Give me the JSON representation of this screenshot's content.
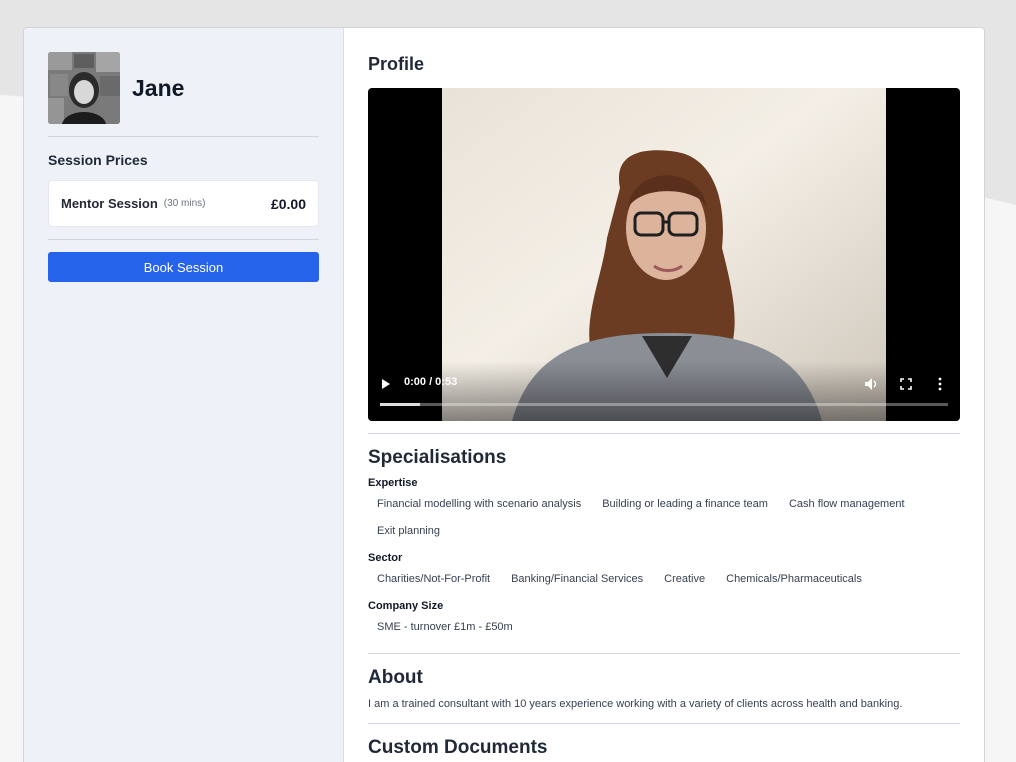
{
  "mentor": {
    "name": "Jane"
  },
  "session_prices": {
    "title": "Session Prices",
    "items": [
      {
        "name": "Mentor Session",
        "duration": "(30 mins)",
        "price": "£0.00"
      }
    ],
    "book_label": "Book Session"
  },
  "profile": {
    "title": "Profile",
    "video": {
      "time": "0:00 / 0:53",
      "progress": 0.07
    }
  },
  "specialisations": {
    "title": "Specialisations",
    "groups": [
      {
        "label": "Expertise",
        "tags": [
          "Financial modelling with scenario analysis",
          "Building or leading a finance team",
          "Cash flow management",
          "Exit planning"
        ]
      },
      {
        "label": "Sector",
        "tags": [
          "Charities/Not-For-Profit",
          "Banking/Financial Services",
          "Creative",
          "Chemicals/Pharmaceuticals"
        ]
      },
      {
        "label": "Company Size",
        "tags": [
          "SME - turnover £1m - £50m"
        ]
      }
    ]
  },
  "about": {
    "title": "About",
    "text": "I am a trained consultant with 10 years experience working with a variety of clients across health and banking."
  },
  "documents": {
    "title": "Custom Documents"
  },
  "icons": {
    "play": "play-icon",
    "volume": "volume-icon",
    "fullscreen": "fullscreen-icon",
    "more": "more-vertical-icon"
  },
  "colors": {
    "accent": "#2563eb",
    "sidebar_bg": "#eef2f8",
    "text": "#1f2937"
  }
}
